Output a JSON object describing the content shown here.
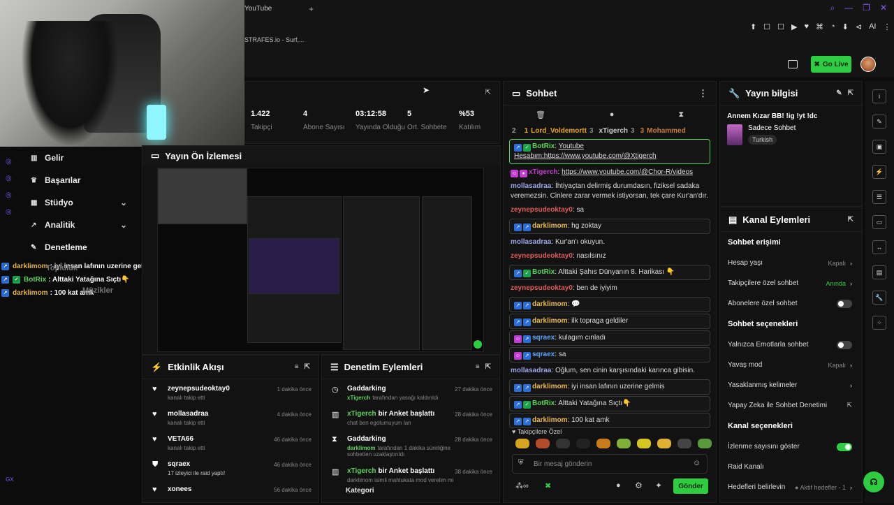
{
  "browser": {
    "tab_title": "r - YouTube",
    "tab2_title": "STRAFES.io - Surf,...",
    "win_controls": [
      "⌕",
      "—",
      "❐",
      "✕"
    ],
    "ext_icons": [
      "⬆",
      "☐",
      "☐",
      "▶",
      "♥",
      "⌘",
      "◔",
      "⬇",
      "⊲",
      "AI",
      "⋮"
    ]
  },
  "header": {
    "go_live": "Go Live"
  },
  "stats": [
    {
      "value": "1.422",
      "label": "Takipçi"
    },
    {
      "value": "4",
      "label": "Abone Sayısı"
    },
    {
      "value": "03:12:58",
      "label": "Yayında Olduğu"
    },
    {
      "value": "5",
      "label": "Ort. Sohbete"
    },
    {
      "value": "%53",
      "label": "Katılım"
    }
  ],
  "nav": [
    {
      "label": "Gelir",
      "icon": "bar-chart-icon",
      "chevron": false
    },
    {
      "label": "Başarılar",
      "icon": "trophy-icon",
      "chevron": false
    },
    {
      "label": "Stüdyo",
      "icon": "studio-icon",
      "chevron": true
    },
    {
      "label": "Analitik",
      "icon": "analytics-icon",
      "chevron": true
    },
    {
      "label": "Denetleme",
      "icon": "wrench-icon",
      "chevron": false
    }
  ],
  "overlay_chat": [
    {
      "user": "darklimom",
      "text": ": iyi insan lafının uzerine gelmis"
    },
    {
      "user": "BotRix",
      "text": ": Alttaki Yatağına Sıçtı👇"
    },
    {
      "user": "darklimom",
      "text": ": 100 kat amk"
    }
  ],
  "overlay_ghost": [
    "Topluluk",
    "Müzikler"
  ],
  "preview": {
    "title": "Yayın Ön İzlemesi"
  },
  "events": {
    "title": "Etkinlik Akışı",
    "items": [
      {
        "name": "zeynepsudeoktay0",
        "desc": "kanalı takip etti",
        "time": "1 dakika önce",
        "icon": "heart-icon"
      },
      {
        "name": "mollasadraa",
        "desc": "kanalı takip etti",
        "time": "4 dakika önce",
        "icon": "heart-icon"
      },
      {
        "name": "VETA66",
        "desc": "kanalı takip etti",
        "time": "46 dakika önce",
        "icon": "heart-icon"
      },
      {
        "name": "sqraex",
        "desc": "17 izleyici ile raid yaptı!",
        "time": "46 dakika önce",
        "icon": "raid-icon"
      },
      {
        "name": "xonees",
        "desc": "",
        "time": "56 dakika önce",
        "icon": "heart-icon"
      }
    ]
  },
  "moderation": {
    "title": "Denetim Eylemleri",
    "items": [
      {
        "name": "Gaddarking",
        "desc_user": "xTigerch",
        "desc": "tarafından yasağı kaldırıldı",
        "time": "27 dakika önce",
        "icon": "clock-icon"
      },
      {
        "name": "xTigerch",
        "name_suffix": "bir Anket başlattı",
        "desc": "chat ben egolumuyum lan",
        "time": "28 dakika önce",
        "icon": "poll-icon"
      },
      {
        "name": "Gaddarking",
        "desc_user": "darklimom",
        "desc": "tarafından 1 dakika süreliğine sohbetten uzaklaştırıldı",
        "time": "28 dakika önce",
        "icon": "hourglass-icon"
      },
      {
        "name": "xTigerch",
        "name_suffix": "bir Anket başlattı",
        "desc": "darklimom isimli mahlukata mod verelim mi",
        "time": "38 dakika önce",
        "icon": "poll-icon"
      }
    ],
    "cut": "Kategori"
  },
  "chat": {
    "title": "Sohbet",
    "leaders": [
      {
        "rank": "2",
        "name": "",
        "score": ""
      },
      {
        "rank": "1",
        "name": "Lord_Voldemortt",
        "score": "3"
      },
      {
        "rank": "",
        "name": "xTigerch",
        "score": "3"
      },
      {
        "rank": "3",
        "name": "Mohammed",
        "score": ""
      }
    ],
    "messages": [
      {
        "user": "BotRix",
        "color": "#5dd35d",
        "text": "Youtube Hesabım:https://www.youtube.com/@Xtigerch",
        "style": "green",
        "badges": [
          "blue",
          "green"
        ]
      },
      {
        "user": "xTigerch",
        "color": "#c43bd1",
        "text": "https://www.youtube.com/@Chor-R/videos",
        "style": "",
        "badges": [
          "pink",
          "mic"
        ]
      },
      {
        "user": "mollasadraa",
        "color": "#9ea6e8",
        "text": "İhtiyaçtan delirmiş durumdasın, fiziksel sadaka veremezsin. Cinlere zarar vermek istiyorsan, tek çare Kur'an'dır.",
        "style": "",
        "badges": []
      },
      {
        "user": "zeynepsudeoktay0",
        "color": "#e05a5a",
        "text": "sa",
        "style": "",
        "badges": []
      },
      {
        "user": "darklimom",
        "color": "#e8b84a",
        "text": "hg zoktay",
        "style": "hl",
        "badges": [
          "blue",
          "blue"
        ]
      },
      {
        "user": "mollasadraa",
        "color": "#9ea6e8",
        "text": "Kur'an'ı okuyun.",
        "style": "",
        "badges": []
      },
      {
        "user": "zeynepsudeoktay0",
        "color": "#e05a5a",
        "text": "nasılsınız",
        "style": "",
        "badges": []
      },
      {
        "user": "BotRix",
        "color": "#5dd35d",
        "text": "Alttaki Şahıs Dünyanın 8. Harikası 👇",
        "style": "hl",
        "badges": [
          "blue",
          "green"
        ]
      },
      {
        "user": "zeynepsudeoktay0",
        "color": "#e05a5a",
        "text": "ben de iyiyim",
        "style": "",
        "badges": []
      },
      {
        "user": "darklimom",
        "color": "#e8b84a",
        "text": "💬",
        "style": "hl",
        "badges": [
          "blue",
          "blue"
        ]
      },
      {
        "user": "darklimom",
        "color": "#e8b84a",
        "text": "ilk topraga geldiler",
        "style": "hl",
        "badges": [
          "blue",
          "blue"
        ]
      },
      {
        "user": "sqraex",
        "color": "#5aa6ff",
        "text": "kulagım cınladı",
        "style": "hl",
        "badges": [
          "pink",
          "blue"
        ]
      },
      {
        "user": "sqraex",
        "color": "#5aa6ff",
        "text": "sa",
        "style": "hl",
        "badges": [
          "pink",
          "blue"
        ]
      },
      {
        "user": "mollasadraa",
        "color": "#9ea6e8",
        "text": "Oğlum, sen cinin karşısındaki karınca gibisin.",
        "style": "",
        "badges": []
      },
      {
        "user": "darklimom",
        "color": "#e8b84a",
        "text": "iyi insan lafının uzerine gelmis",
        "style": "hl",
        "badges": [
          "blue",
          "blue"
        ]
      },
      {
        "user": "BotRix",
        "color": "#5dd35d",
        "text": "Alttaki Yatağına Sıçtı👇",
        "style": "hl",
        "badges": [
          "blue",
          "green"
        ]
      },
      {
        "user": "darklimom",
        "color": "#e8b84a",
        "text": "100 kat amk",
        "style": "hl",
        "badges": [
          "blue",
          "blue"
        ]
      }
    ],
    "followers_only": "Takipçilere Özel",
    "input_placeholder": "Bir mesaj gönderin",
    "send": "Gönder"
  },
  "info": {
    "title": "Yayın bilgisi",
    "stream_title": "Annem Kızar BB! !ig !yt !dc",
    "category": "Sadece Sohbet",
    "tag": "Turkish"
  },
  "actions": {
    "title": "Kanal Eylemleri",
    "sections": [
      {
        "heading": "Sohbet erişimi",
        "rows": [
          {
            "label": "Hesap yaşı",
            "value": "Kapalı",
            "type": "chevron",
            "value_color": "#888"
          },
          {
            "label": "Takipçilere özel sohbet",
            "value": "Anında",
            "type": "chevron",
            "value_color": "#2ecc40"
          },
          {
            "label": "Abonelere özel sohbet",
            "value": "",
            "type": "toggle-off",
            "value_color": "#888"
          }
        ]
      },
      {
        "heading": "Sohbet seçenekleri",
        "rows": [
          {
            "label": "Yalnızca Emotlarla sohbet",
            "value": "",
            "type": "toggle-off",
            "value_color": "#888"
          },
          {
            "label": "Yavaş mod",
            "value": "Kapalı",
            "type": "chevron",
            "value_color": "#888"
          },
          {
            "label": "Yasaklanmış kelimeler",
            "value": "",
            "type": "chevron",
            "value_color": "#888"
          },
          {
            "label": "Yapay Zeka ile Sohbet Denetimi",
            "value": "",
            "type": "external",
            "value_color": "#888"
          }
        ]
      },
      {
        "heading": "Kanal seçenekleri",
        "rows": [
          {
            "label": "İzlenme sayısını göster",
            "value": "",
            "type": "toggle-on",
            "value_color": "#888"
          },
          {
            "label": "Raid Kanalı",
            "value": "",
            "type": "none",
            "value_color": "#888"
          },
          {
            "label": "Hedefleri belirlevin",
            "value": "● Aktif hedefler - 1",
            "type": "chevron",
            "value_color": "#888"
          }
        ]
      }
    ]
  },
  "rail": [
    "i",
    "✎",
    "▣",
    "⚡",
    "☰",
    "▭",
    "↔",
    "▤",
    "🔧",
    "⁘"
  ]
}
